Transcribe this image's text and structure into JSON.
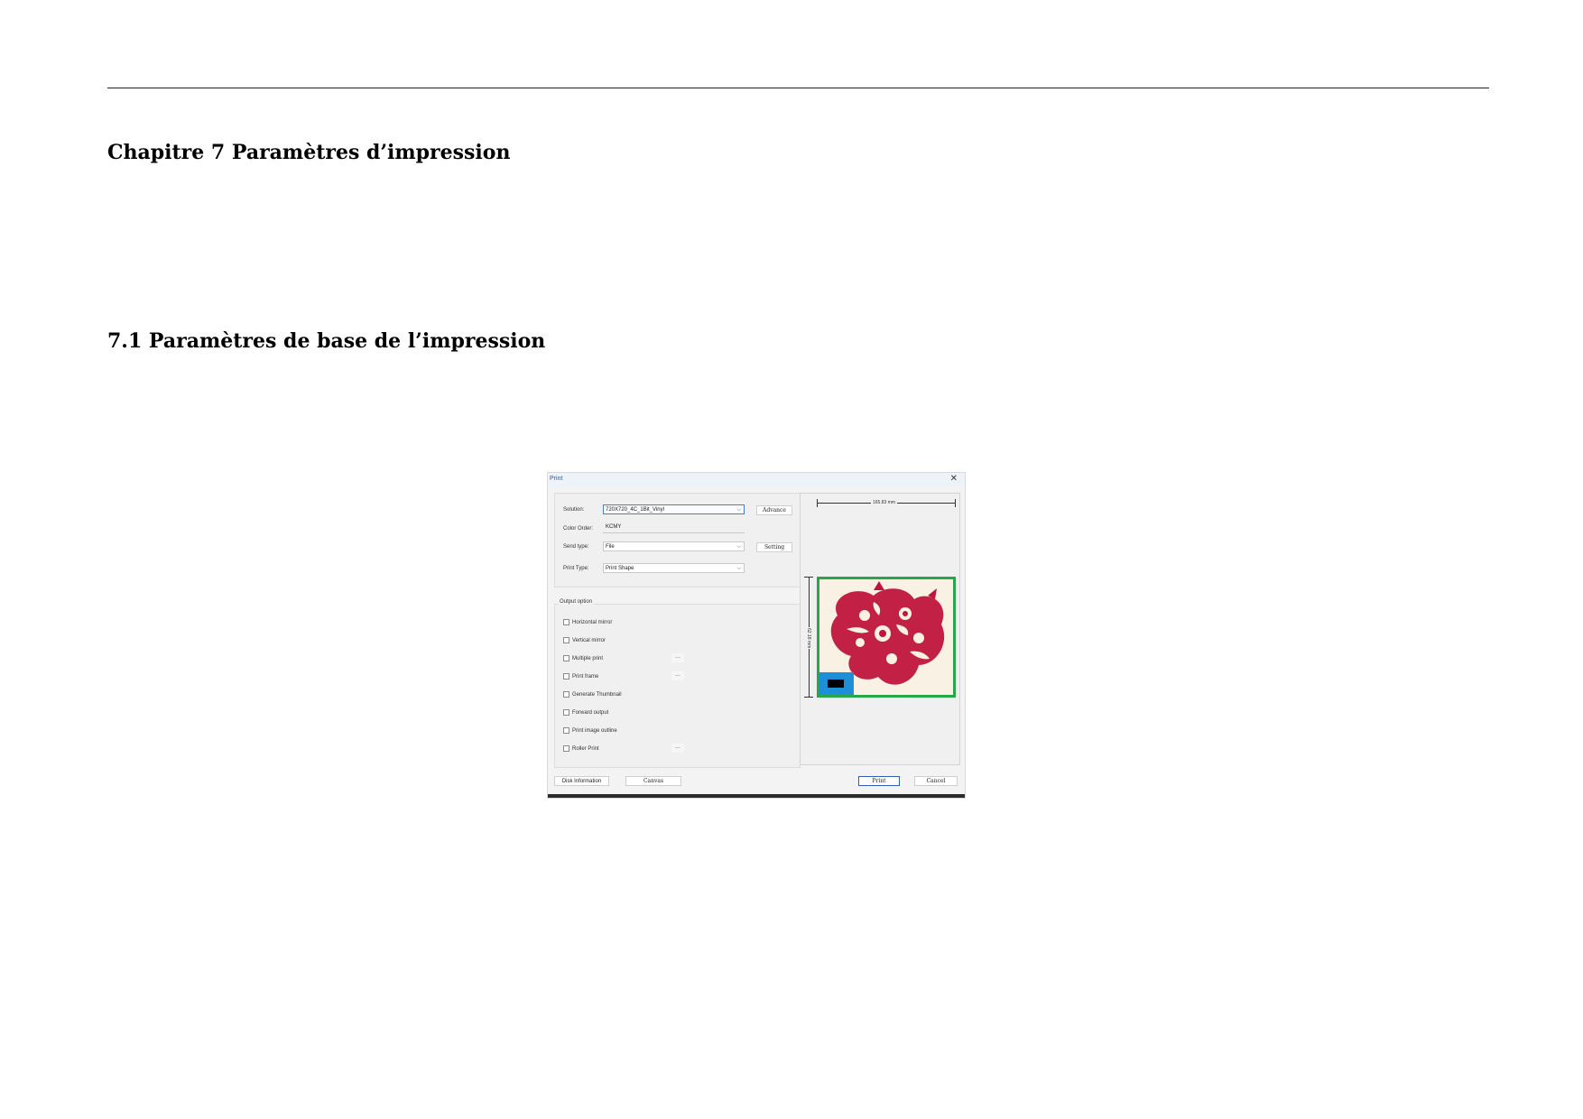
{
  "document": {
    "chapter_title": "Chapitre 7 Paramètres d’impression",
    "section_title": "7.1 Paramètres de base de l’impression"
  },
  "dialog": {
    "title": "Print",
    "close_icon": "close-icon",
    "settings": {
      "solution_label": "Solution:",
      "solution_value": "720X720_4C_1Bit_Vinyl",
      "advance_label": "Advance",
      "color_order_label": "Color Order:",
      "color_order_value": "KCMY",
      "send_type_label": "Send type:",
      "send_type_value": "File",
      "setting_label": "Setting",
      "print_type_label": "Print Type:",
      "print_type_value": "Print Shape"
    },
    "output_option": {
      "label": "Output option",
      "items": [
        {
          "label": "Horizontal mirror",
          "checked": false,
          "has_more": false
        },
        {
          "label": "Vertical mirror",
          "checked": false,
          "has_more": false
        },
        {
          "label": "Multiple print",
          "checked": false,
          "has_more": true
        },
        {
          "label": "Print frame",
          "checked": false,
          "has_more": true
        },
        {
          "label": "Generate Thumbnail",
          "checked": false,
          "has_more": false
        },
        {
          "label": "Forward output",
          "checked": false,
          "has_more": false
        },
        {
          "label": "Print image outline",
          "checked": false,
          "has_more": false
        },
        {
          "label": "Roller Print",
          "checked": false,
          "has_more": true
        }
      ],
      "more_label": "..."
    },
    "preview": {
      "width_label": "165.83 mm",
      "height_label": "62.18 mm",
      "frame_color": "#25a74a",
      "art_color": "#c0143c",
      "marker_color": "#1e8fd6"
    },
    "buttons": {
      "disk_information": "Disk Information",
      "canvas": "Canvas",
      "print": "Print",
      "cancel": "Cancel"
    }
  }
}
